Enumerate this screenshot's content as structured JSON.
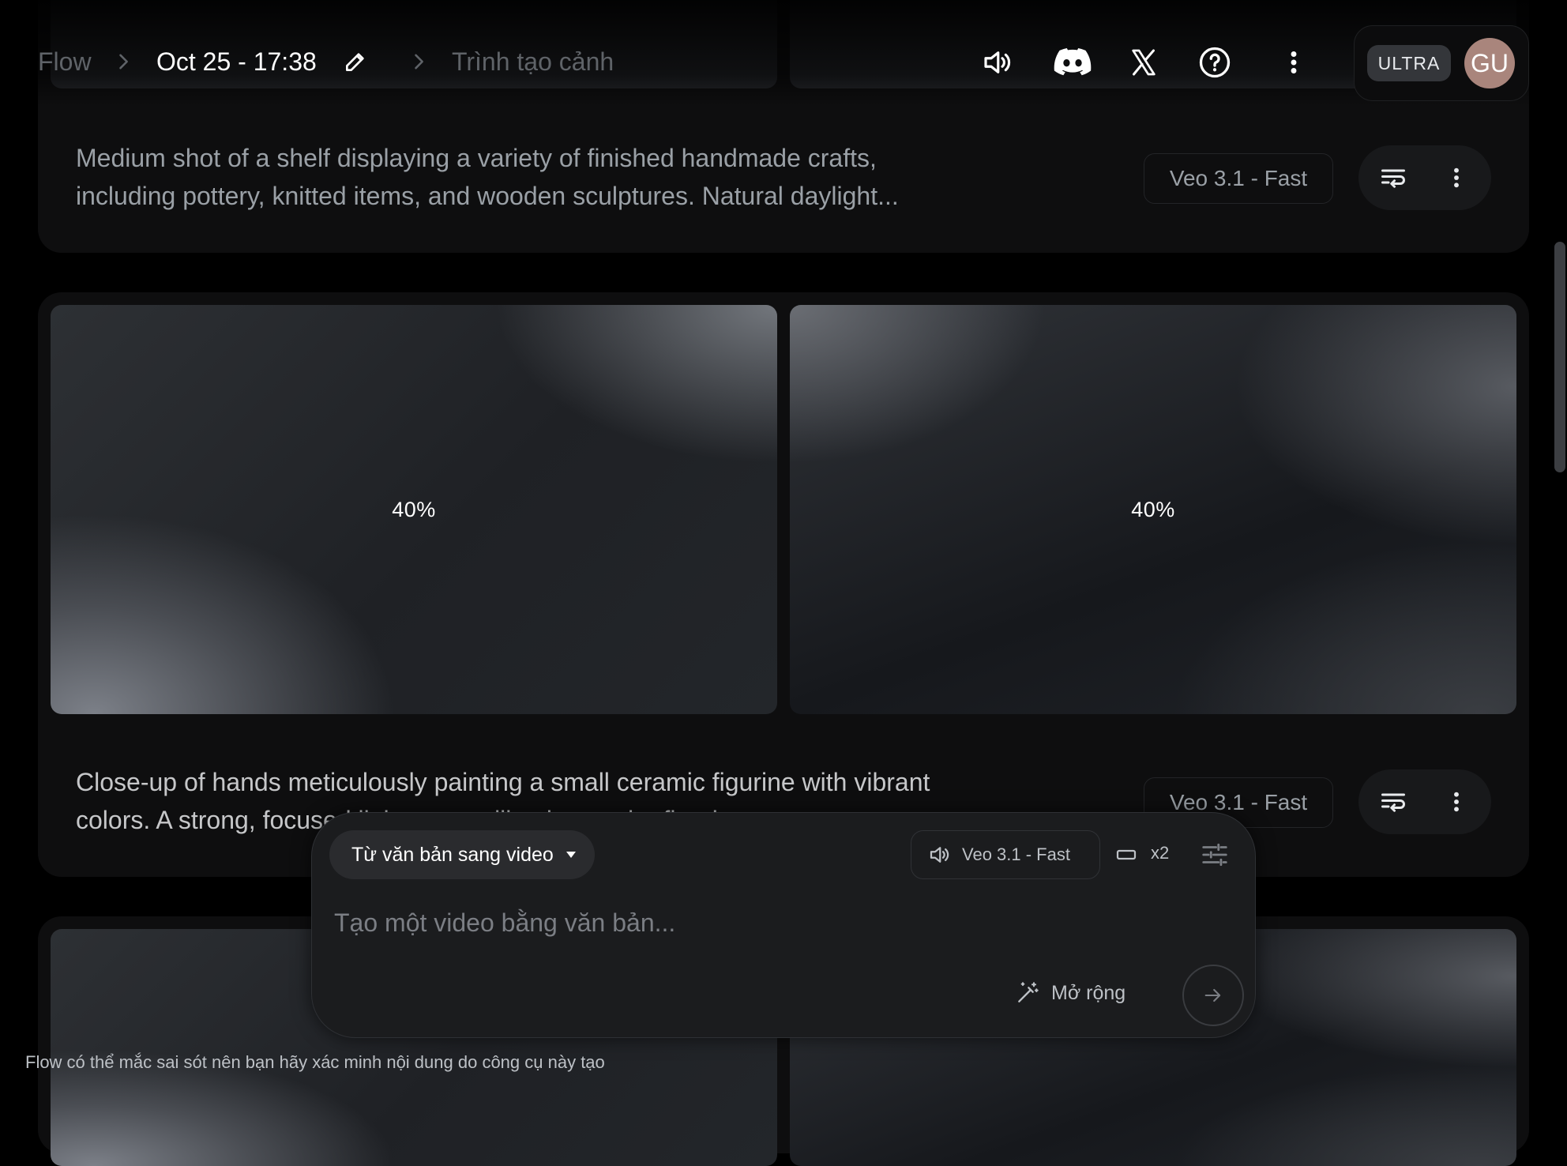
{
  "header": {
    "breadcrumb_root": "Flow",
    "project_name": "Oct 25 - 17:38",
    "page_name": "Trình tạo cảnh",
    "icons": [
      "volume-icon",
      "discord-icon",
      "x-icon",
      "help-icon",
      "more-vert-icon",
      "pencil-icon"
    ],
    "plan_badge": "ULTRA",
    "avatar_initials": "GU",
    "avatar_color": "#a9857c"
  },
  "scenes": [
    {
      "prompt": "Medium shot of a shelf displaying a variety of finished handmade crafts, including pottery, knitted items, and wooden sculptures. Natural daylight...",
      "model": "Veo 3.1 - Fast"
    },
    {
      "thumbnails": [
        {
          "progress": "40%"
        },
        {
          "progress": "40%"
        }
      ],
      "prompt": "Close-up of hands meticulously painting a small ceramic figurine with vibrant colors. A strong, focused light source illuminates the figurine...",
      "model": "Veo 3.1 - Fast"
    }
  ],
  "composer": {
    "mode": "Từ văn bản sang video",
    "model": "Veo 3.1 - Fast",
    "output_count": "x2",
    "placeholder": "Tạo một video bằng văn bản...",
    "expand_label": "Mở rộng"
  },
  "footer": {
    "disclaimer": "Flow có thể mắc sai sót nên bạn hãy xác minh nội dung do công cụ này tạo"
  },
  "colors": {
    "background": "#000000",
    "card": "#0e0e0f",
    "composer": "#1b1c1e",
    "muted_text": "#9aa0a6"
  }
}
